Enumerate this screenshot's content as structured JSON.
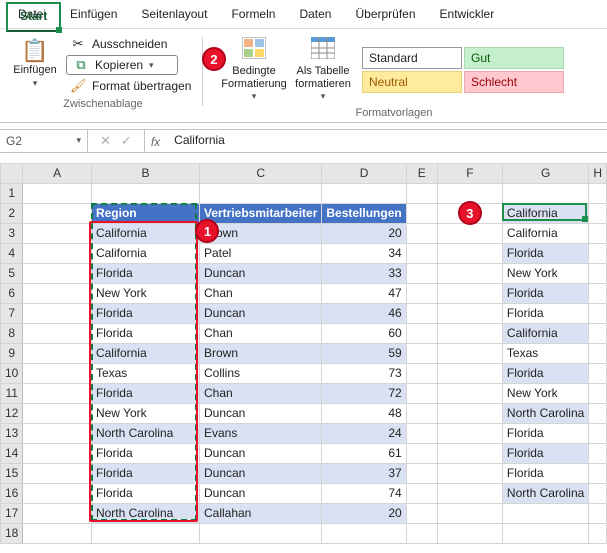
{
  "tabs": [
    "Datei",
    "Start",
    "Einfügen",
    "Seitenlayout",
    "Formeln",
    "Daten",
    "Überprüfen",
    "Entwickler"
  ],
  "activeTab": 1,
  "clipboard": {
    "paste": "Einfügen",
    "cut": "Ausschneiden",
    "copy": "Kopieren",
    "format": "Format übertragen",
    "group": "Zwischenablage"
  },
  "cond": {
    "label": "Bedingte\nFormatierung"
  },
  "tableFmt": {
    "label": "Als Tabelle\nformatieren"
  },
  "styles": {
    "std": "Standard",
    "gut": "Gut",
    "neu": "Neutral",
    "sch": "Schlecht",
    "group": "Formatvorlagen"
  },
  "namebox": "G2",
  "fx": "California",
  "cols": [
    "A",
    "B",
    "C",
    "D",
    "E",
    "F",
    "G",
    "H"
  ],
  "header": {
    "b": "Region",
    "c": "Vertriebsmitarbeiter",
    "d": "Bestellungen"
  },
  "rows": [
    {
      "n": 2,
      "g": "California"
    },
    {
      "n": 3,
      "b": "California",
      "c": "Brown",
      "d": 20,
      "g": "California"
    },
    {
      "n": 4,
      "b": "California",
      "c": "Patel",
      "d": 34,
      "g": "Florida"
    },
    {
      "n": 5,
      "b": "Florida",
      "c": "Duncan",
      "d": 33,
      "g": "New York"
    },
    {
      "n": 6,
      "b": "New York",
      "c": "Chan",
      "d": 47,
      "g": "Florida"
    },
    {
      "n": 7,
      "b": "Florida",
      "c": "Duncan",
      "d": 46,
      "g": "Florida"
    },
    {
      "n": 8,
      "b": "Florida",
      "c": "Chan",
      "d": 60,
      "g": "California"
    },
    {
      "n": 9,
      "b": "California",
      "c": "Brown",
      "d": 59,
      "g": "Texas"
    },
    {
      "n": 10,
      "b": "Texas",
      "c": "Collins",
      "d": 73,
      "g": "Florida"
    },
    {
      "n": 11,
      "b": "Florida",
      "c": "Chan",
      "d": 72,
      "g": "New York"
    },
    {
      "n": 12,
      "b": "New York",
      "c": "Duncan",
      "d": 48,
      "g": "North Carolina"
    },
    {
      "n": 13,
      "b": "North Carolina",
      "c": "Evans",
      "d": 24,
      "g": "Florida"
    },
    {
      "n": 14,
      "b": "Florida",
      "c": "Duncan",
      "d": 61,
      "g": "Florida"
    },
    {
      "n": 15,
      "b": "Florida",
      "c": "Duncan",
      "d": 37,
      "g": "Florida"
    },
    {
      "n": 16,
      "b": "Florida",
      "c": "Duncan",
      "d": 74,
      "g": "North Carolina"
    },
    {
      "n": 17,
      "b": "North Carolina",
      "c": "Callahan",
      "d": 20,
      "g": ""
    },
    {
      "n": 18
    }
  ],
  "badges": {
    "1": "1",
    "2": "2",
    "3": "3"
  }
}
